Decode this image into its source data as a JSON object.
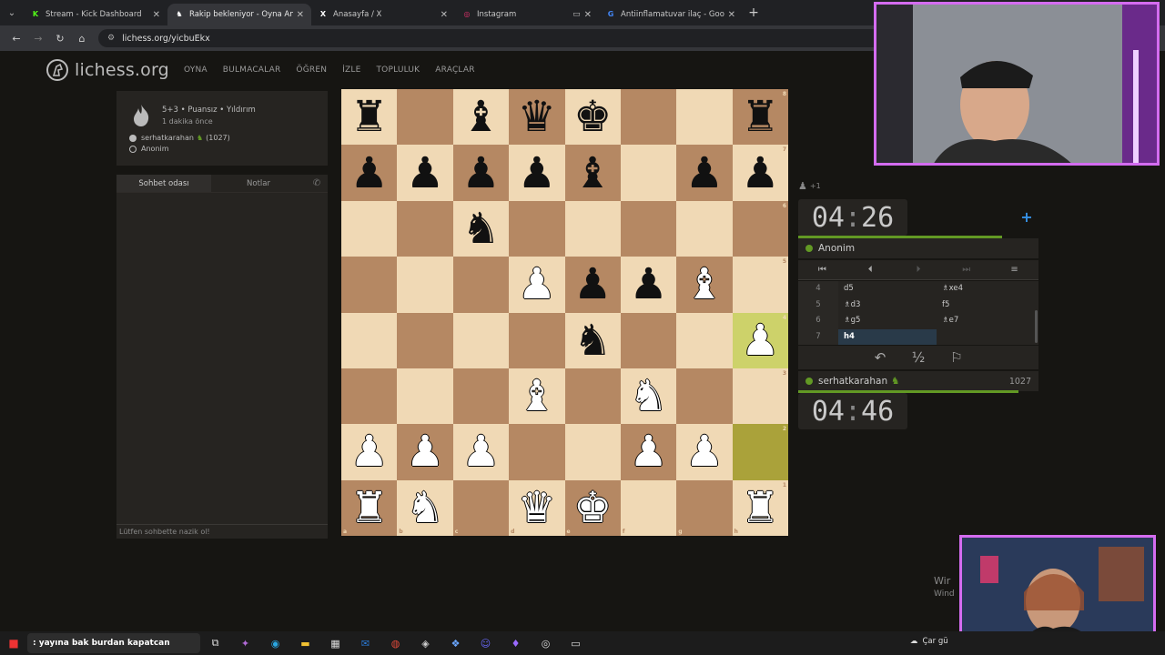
{
  "browser": {
    "tabs": [
      {
        "title": "Stream - Kick Dashboard",
        "active": false,
        "fav": "K",
        "fav_color": "#53fc18"
      },
      {
        "title": "Rakip bekleniyor - Oyna Anonim",
        "active": true,
        "fav": "♞",
        "fav_color": "#ffffff"
      },
      {
        "title": "Anasayfa / X",
        "active": false,
        "fav": "X",
        "fav_color": "#ffffff"
      },
      {
        "title": "Instagram",
        "active": false,
        "fav": "◎",
        "fav_color": "#e1306c"
      },
      {
        "title": "Antiinflamatuvar ilaç - Google'da Ara",
        "active": false,
        "fav": "G",
        "fav_color": "#4285f4"
      }
    ],
    "url": "lichess.org/yicbuEkx"
  },
  "site": {
    "logo_text": "lichess.org",
    "nav": [
      "OYNA",
      "BULMACALAR",
      "ÖĞREN",
      "İZLE",
      "TOPLULUK",
      "ARAÇLAR"
    ]
  },
  "game_info": {
    "line1": "5+3 • Puansız • Yıldırım",
    "line2": "1 dakika önce",
    "white_player": "serhatkarahan",
    "white_rating": "(1027)",
    "black_player": "Anonim"
  },
  "chat": {
    "tab_room": "Sohbet odası",
    "tab_notes": "Notlar",
    "placeholder": "Lütfen sohbette nazik ol!"
  },
  "board": {
    "orientation": "white",
    "ranks": [
      [
        "br",
        "",
        "bb",
        "bq",
        "bk",
        "",
        "",
        "br"
      ],
      [
        "bp",
        "bp",
        "bp",
        "bp",
        "bb",
        "",
        "bp",
        "bp"
      ],
      [
        "",
        "",
        "bn",
        "",
        "",
        "",
        "",
        ""
      ],
      [
        "",
        "",
        "",
        "wp",
        "bp",
        "bp",
        "wb",
        ""
      ],
      [
        "",
        "",
        "",
        "",
        "bn",
        "",
        "",
        "wp"
      ],
      [
        "",
        "",
        "",
        "wb",
        "",
        "wn",
        "",
        ""
      ],
      [
        "wp",
        "wp",
        "wp",
        "",
        "",
        "wp",
        "wp",
        ""
      ],
      [
        "wr",
        "wn",
        "",
        "wq",
        "wk",
        "",
        "",
        "wr"
      ]
    ],
    "highlight_squares": [
      "h4",
      "h2"
    ],
    "rank_labels": [
      "8",
      "7",
      "6",
      "5",
      "4",
      "3",
      "2",
      "1"
    ],
    "file_labels": [
      "a",
      "b",
      "c",
      "d",
      "e",
      "f",
      "g",
      "h"
    ]
  },
  "right_panel": {
    "spectators": "+1",
    "top_clock": {
      "min": "04",
      "sec": "26"
    },
    "top_player": "Anonim",
    "moves": [
      {
        "num": "4",
        "white": "d5",
        "black": "♗xe4"
      },
      {
        "num": "5",
        "white": "♗d3",
        "black": "f5"
      },
      {
        "num": "6",
        "white": "♗g5",
        "black": "♗e7"
      },
      {
        "num": "7",
        "white": "h4",
        "black": ""
      }
    ],
    "bottom_player": "serhatkarahan",
    "bottom_rating": "1027",
    "bottom_clock": {
      "min": "04",
      "sec": "46"
    },
    "draw_label": "½"
  },
  "overlay": {
    "win_line1": "Wir",
    "win_line2": "Wind"
  },
  "taskbar": {
    "search_text": ": yayına bak burdan kapatcan",
    "weather": "Çar gü"
  }
}
